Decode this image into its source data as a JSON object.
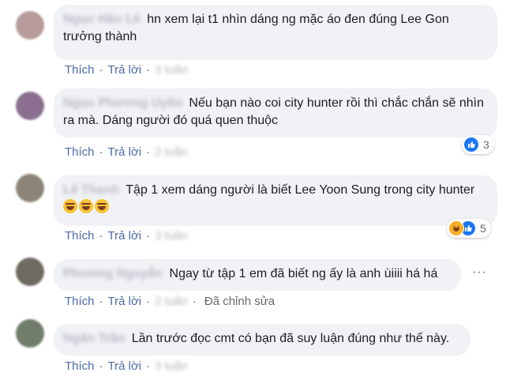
{
  "actions": {
    "like": "Thích",
    "reply": "Trả lời",
    "sep": "·"
  },
  "comments": [
    {
      "author": "Ngọc Hân Lê",
      "text": "hn xem lại t1 nhìn dáng ng mặc áo đen đúng Lee Gon trưởng thành",
      "time": "3 tuần"
    },
    {
      "author": "Ngọc Phương Uyên",
      "text": "Nếu bạn nào coi city hunter rồi thì chắc chắn sẽ nhìn ra mà. Dáng người đó quá quen thuộc",
      "time": "2 tuần",
      "reaction_count": "3"
    },
    {
      "author": "Lê Thanh",
      "text": "Tập 1 xem dáng người là biết Lee Yoon Sung trong city hunter",
      "time": "3 tuần",
      "reaction_count": "5"
    },
    {
      "author": "Phương Nguyễn",
      "text": "Ngay từ tập 1 em đã biết ng ấy là anh ùiiii há há",
      "time": "2 tuần",
      "edited": "Đã chỉnh sửa",
      "more": "···"
    },
    {
      "author": "Ngân Trần",
      "text": "Lần trước đọc cmt có bạn đã suy luận đúng như thế này.",
      "time": "3 tuần"
    }
  ],
  "colors": {
    "bubble": "#f0f2f5",
    "link": "#4b6aa7",
    "like": "#1877f2",
    "haha": "#f7b125"
  },
  "icons": [
    "like-icon",
    "haha-icon",
    "more-options-icon"
  ]
}
